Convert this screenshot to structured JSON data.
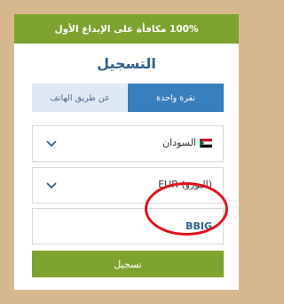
{
  "banner": {
    "text": "100% مكافأة على الإيداع الأول"
  },
  "title": "التسجيل",
  "tabs": [
    {
      "label": "نقرة واحدة",
      "active": true
    },
    {
      "label": "عن طريق الهاتف",
      "active": false
    }
  ],
  "country": {
    "value": "السودان",
    "flag_icon": "sudan-flag-icon"
  },
  "currency": {
    "value": "EUR (اليورو)"
  },
  "promo": {
    "value": "BBIG"
  },
  "submit": {
    "label": "تسجيل"
  },
  "colors": {
    "background": "#d5b88e",
    "accent_green": "#7ea22e",
    "tab_active": "#3a7fbd",
    "title_blue": "#2f5f8f",
    "highlight_red": "#e0101a"
  }
}
